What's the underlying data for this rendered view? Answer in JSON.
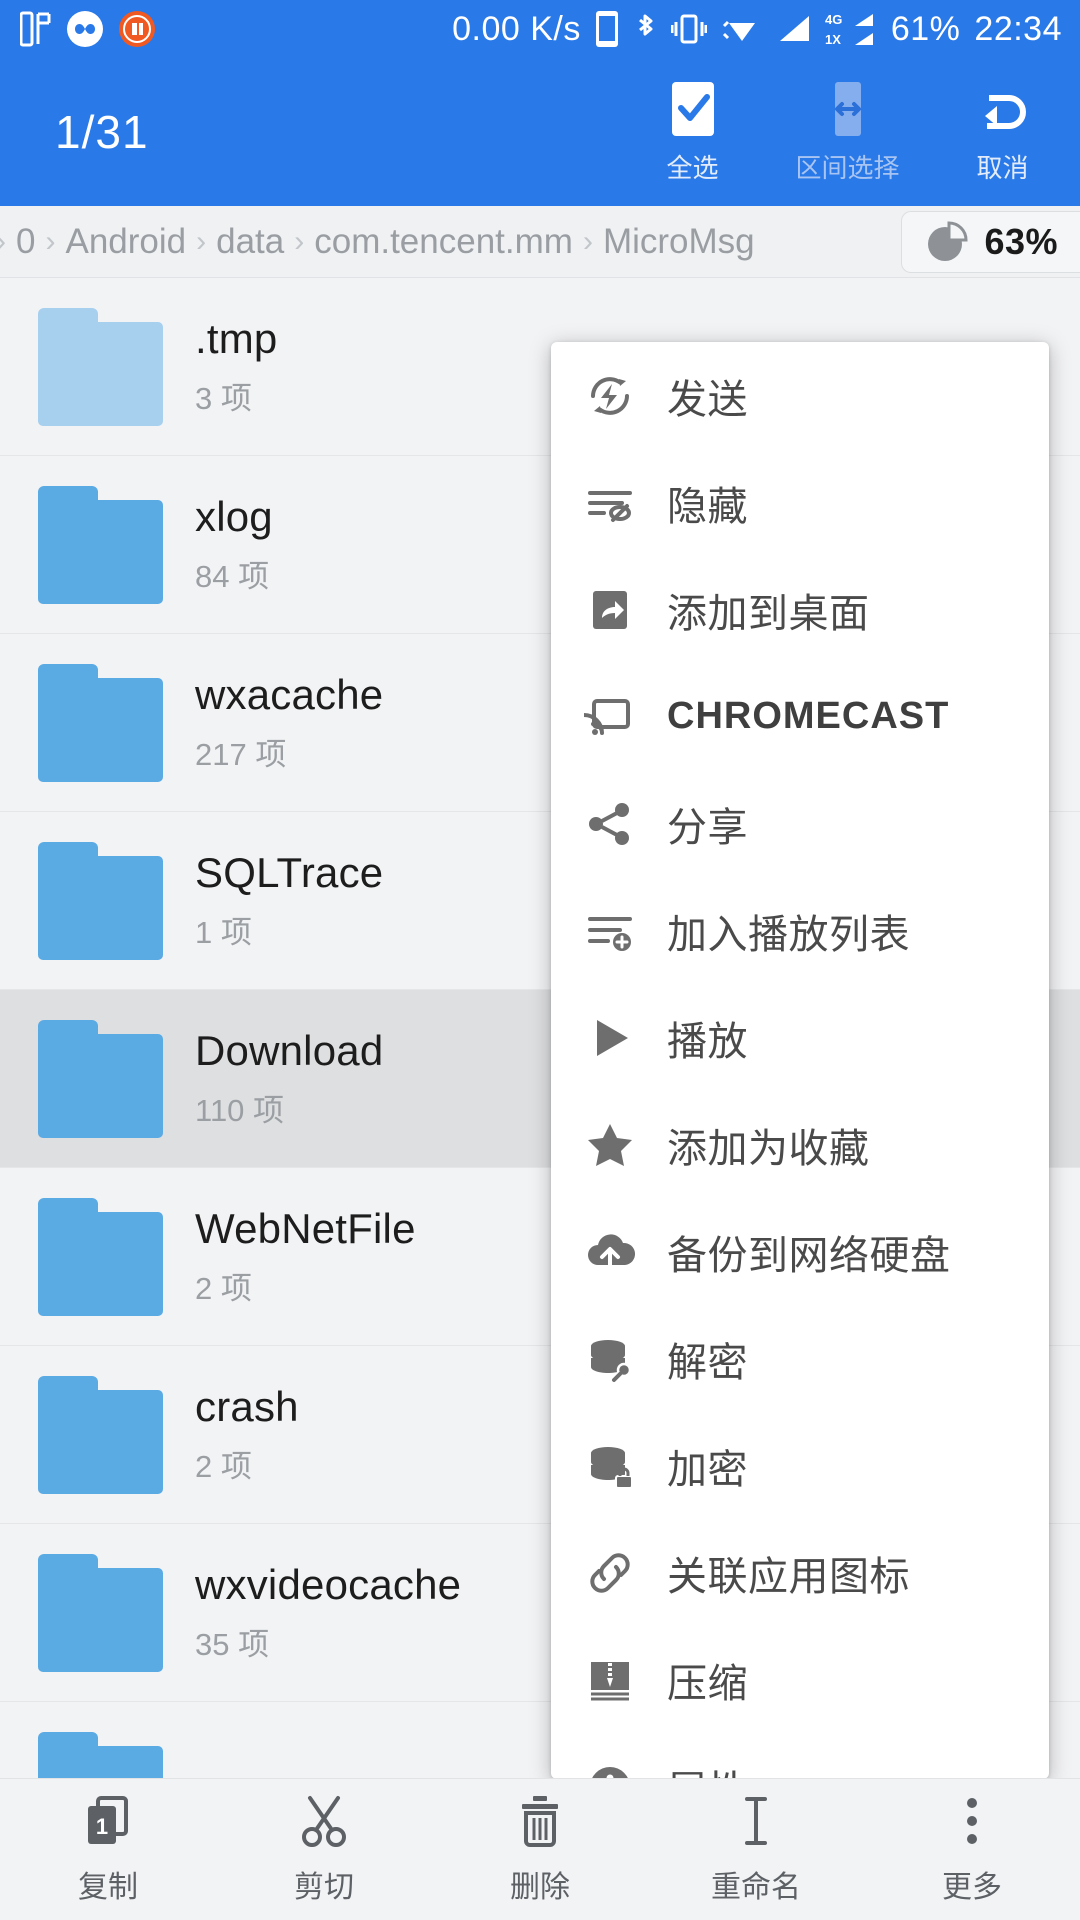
{
  "statusbar": {
    "left_icons": [
      "music-notes-icon",
      "infinity-badge-icon",
      "mi-logo-icon"
    ],
    "network_speed": "0.00 K/s",
    "right_icons": [
      "phone-icon",
      "bluetooth-icon",
      "vibrate-icon",
      "wifi-icon",
      "signal-icon",
      "dual-sim-signal-icon"
    ],
    "sim_labels": [
      "4G",
      "1X"
    ],
    "battery": "61%",
    "clock": "22:34"
  },
  "actionbar": {
    "selection_count": "1/31",
    "actions": [
      {
        "label": "全选",
        "icon": "check-box-icon"
      },
      {
        "label": "区间选择",
        "icon": "range-select-icon"
      },
      {
        "label": "取消",
        "icon": "undo-arrow-icon"
      }
    ]
  },
  "breadcrumb": {
    "items": [
      "0",
      "Android",
      "data",
      "com.tencent.mm",
      "MicroMsg"
    ],
    "separator": "›",
    "storage": {
      "percent": "63%",
      "icon": "pie-chart-icon"
    }
  },
  "filelist": {
    "item_suffix": "项",
    "rows": [
      {
        "name": ".tmp",
        "count": "3 项",
        "icon": "folder-icon-pale",
        "selected": false
      },
      {
        "name": "xlog",
        "count": "84 项",
        "icon": "folder-icon",
        "selected": false
      },
      {
        "name": "wxacache",
        "count": "217 项",
        "icon": "folder-icon",
        "selected": false
      },
      {
        "name": "SQLTrace",
        "count": "1 项",
        "icon": "folder-icon",
        "selected": false
      },
      {
        "name": "Download",
        "count": "110 项",
        "icon": "folder-icon",
        "selected": true
      },
      {
        "name": "WebNetFile",
        "count": "2 项",
        "icon": "folder-icon",
        "selected": false
      },
      {
        "name": "crash",
        "count": "2 项",
        "icon": "folder-icon",
        "selected": false
      },
      {
        "name": "wxvideocache",
        "count": "35 项",
        "icon": "folder-icon",
        "selected": false
      }
    ]
  },
  "contextmenu": {
    "items": [
      {
        "label": "发送",
        "icon": "send-flash-icon"
      },
      {
        "label": "隐藏",
        "icon": "hide-eye-icon"
      },
      {
        "label": "添加到桌面",
        "icon": "add-to-home-icon"
      },
      {
        "label": "CHROMECAST",
        "icon": "cast-icon"
      },
      {
        "label": "分享",
        "icon": "share-icon"
      },
      {
        "label": "加入播放列表",
        "icon": "playlist-add-icon"
      },
      {
        "label": "播放",
        "icon": "play-icon"
      },
      {
        "label": "添加为收藏",
        "icon": "star-icon"
      },
      {
        "label": "备份到网络硬盘",
        "icon": "cloud-upload-icon"
      },
      {
        "label": "解密",
        "icon": "database-key-icon"
      },
      {
        "label": "加密",
        "icon": "database-lock-icon"
      },
      {
        "label": "关联应用图标",
        "icon": "link-icon"
      },
      {
        "label": "压缩",
        "icon": "archive-zip-icon"
      },
      {
        "label": "属性",
        "icon": "info-icon"
      }
    ]
  },
  "bottombar": {
    "items": [
      {
        "label": "复制",
        "icon": "copy-icon",
        "badge": "1"
      },
      {
        "label": "剪切",
        "icon": "scissors-icon"
      },
      {
        "label": "删除",
        "icon": "trash-icon"
      },
      {
        "label": "重命名",
        "icon": "text-cursor-icon"
      },
      {
        "label": "更多",
        "icon": "more-vertical-icon"
      }
    ]
  },
  "colors": {
    "primary": "#2979e8",
    "folder": "#5aaae4",
    "folder_pale": "#a6d0ee",
    "page_bg": "#f2f3f5",
    "selected_row": "#dedfe1"
  }
}
